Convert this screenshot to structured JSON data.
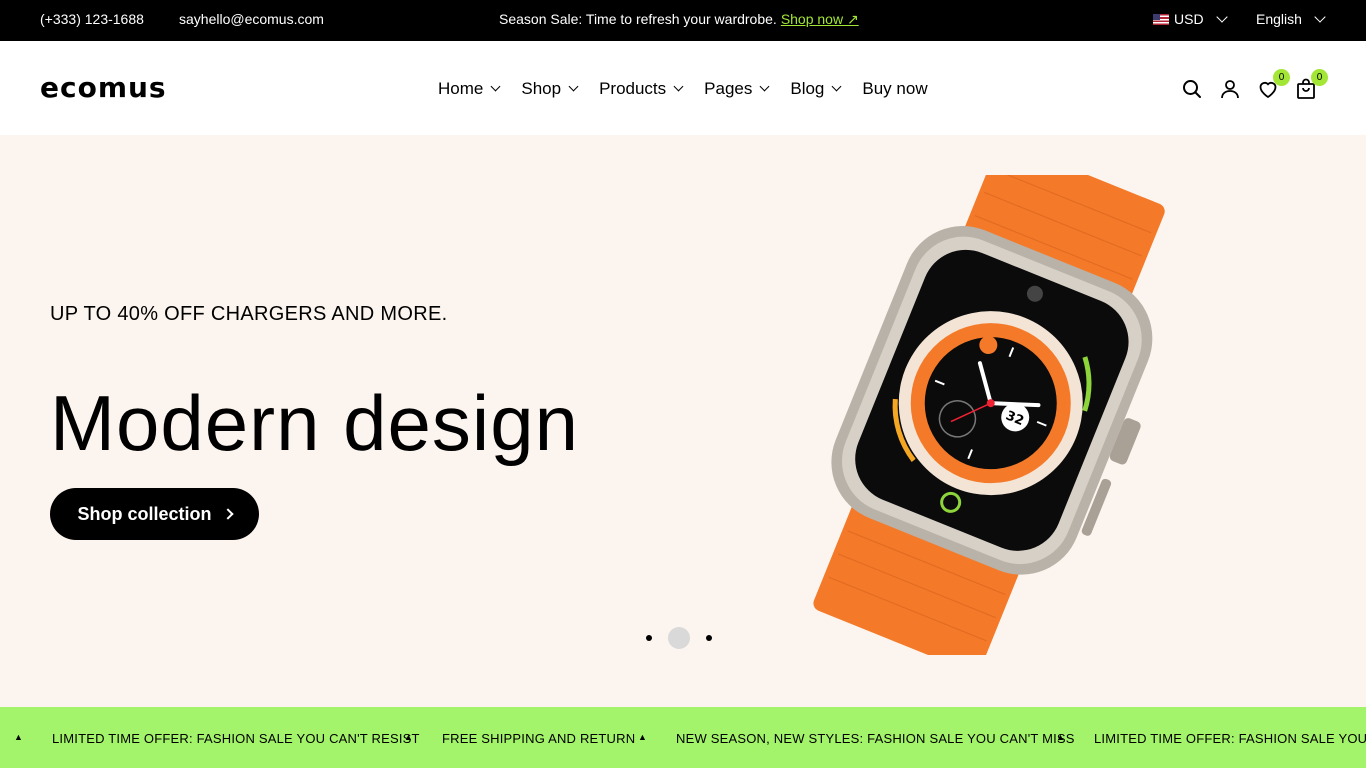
{
  "topbar": {
    "phone": "(+333) 123-1688",
    "email": "sayhello@ecomus.com",
    "promo_text": "Season Sale: Time to refresh your wardrobe.",
    "promo_link": "Shop now ↗",
    "currency": "USD",
    "language": "English"
  },
  "header": {
    "logo": "ecomus",
    "nav": [
      {
        "label": "Home"
      },
      {
        "label": "Shop"
      },
      {
        "label": "Products"
      },
      {
        "label": "Pages"
      },
      {
        "label": "Blog"
      },
      {
        "label": "Buy now"
      }
    ],
    "wishlist_count": "0",
    "cart_count": "0"
  },
  "hero": {
    "eyebrow": "UP TO 40% OFF CHARGERS AND MORE.",
    "headline": "Modern design",
    "cta_label": "Shop collection",
    "slides_total": 3,
    "active_slide": 2
  },
  "marquee": {
    "items": [
      "LIMITED TIME OFFER: FASHION SALE YOU CAN'T RESIST",
      "FREE SHIPPING AND RETURN",
      "NEW SEASON, NEW STYLES: FASHION SALE YOU CAN'T MISS",
      "LIMITED TIME OFFER: FASHION SALE YOU CAN'T RESIST"
    ]
  },
  "colors": {
    "accent": "#a3e635",
    "hero_bg": "#fcf5ef",
    "marquee_bg": "#a3f46a",
    "watch_band": "#f47a2a"
  }
}
